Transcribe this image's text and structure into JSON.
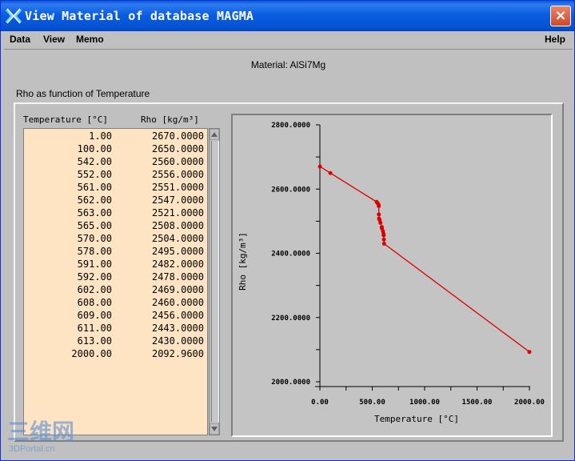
{
  "window": {
    "title": "View Material of database MAGMA",
    "close_symbol": "×"
  },
  "menubar": {
    "items": [
      "Data",
      "View",
      "Memo"
    ],
    "help": "Help"
  },
  "material": {
    "label": "Material: AlSi7Mg"
  },
  "section": {
    "label": "Rho as function of Temperature"
  },
  "table": {
    "headers": [
      "Temperature [°C]",
      "Rho [kg/m³]"
    ],
    "rows": [
      [
        "1.00",
        "2670.0000"
      ],
      [
        "100.00",
        "2650.0000"
      ],
      [
        "542.00",
        "2560.0000"
      ],
      [
        "552.00",
        "2556.0000"
      ],
      [
        "561.00",
        "2551.0000"
      ],
      [
        "562.00",
        "2547.0000"
      ],
      [
        "563.00",
        "2521.0000"
      ],
      [
        "565.00",
        "2508.0000"
      ],
      [
        "570.00",
        "2504.0000"
      ],
      [
        "578.00",
        "2495.0000"
      ],
      [
        "591.00",
        "2482.0000"
      ],
      [
        "592.00",
        "2478.0000"
      ],
      [
        "602.00",
        "2469.0000"
      ],
      [
        "608.00",
        "2460.0000"
      ],
      [
        "609.00",
        "2456.0000"
      ],
      [
        "611.00",
        "2443.0000"
      ],
      [
        "613.00",
        "2430.0000"
      ],
      [
        "2000.00",
        "2092.9600"
      ]
    ]
  },
  "chart_data": {
    "type": "line",
    "xlabel": "Temperature [°C]",
    "ylabel": "Rho [kg/m³]",
    "xlim": [
      0,
      2000
    ],
    "ylim": [
      2000,
      2800
    ],
    "x_ticks": [
      "0.00",
      "500.00",
      "1000.00",
      "1500.00",
      "2000.00"
    ],
    "y_ticks": [
      "2000.0000",
      "2200.0000",
      "2400.0000",
      "2600.0000",
      "2800.0000"
    ],
    "series_color": "#dd0000",
    "x": [
      1,
      100,
      542,
      552,
      561,
      562,
      563,
      565,
      570,
      578,
      591,
      592,
      602,
      608,
      609,
      611,
      613,
      2000
    ],
    "y": [
      2670,
      2650,
      2560,
      2556,
      2551,
      2547,
      2521,
      2508,
      2504,
      2495,
      2482,
      2478,
      2469,
      2460,
      2456,
      2443,
      2430,
      2092.96
    ],
    "markers": [
      1,
      100,
      542,
      552,
      561,
      562,
      563,
      565,
      570,
      578,
      591,
      592,
      602,
      608,
      609,
      611,
      613,
      2000
    ]
  },
  "watermark": {
    "big": "三维网",
    "small": "3DPortal.cn"
  },
  "icons": {
    "app": "x-logo-icon",
    "close": "close-icon",
    "scroll_up": "arrow-up-icon",
    "scroll_down": "arrow-down-icon"
  }
}
